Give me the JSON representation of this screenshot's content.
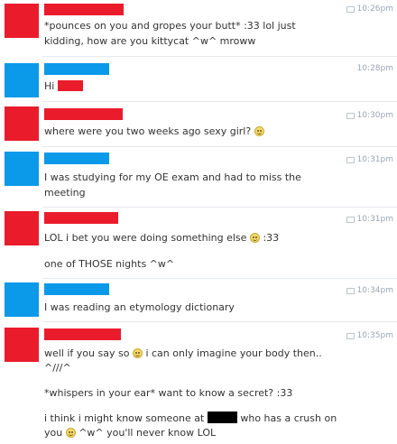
{
  "colors": {
    "user_a": "#ea1c2b",
    "user_b": "#0a9ae9",
    "redaction": "#000000"
  },
  "messages": [
    {
      "sender": "user_a",
      "time": "10:26pm",
      "lines": [
        "*pounces on you and gropes your butt* :33 lol just",
        "kidding, how are you kittycat ^w^ mroww"
      ]
    },
    {
      "sender": "user_b",
      "time": "10:28pm",
      "lines": [
        "Hi"
      ]
    },
    {
      "sender": "user_a",
      "time": "10:30pm",
      "lines": [
        "where were you two weeks ago sexy girl?"
      ]
    },
    {
      "sender": "user_b",
      "time": "10:31pm",
      "lines": [
        "I was studying for my OE exam and had to miss the",
        "meeting"
      ]
    },
    {
      "sender": "user_a",
      "time": "10:31pm",
      "lines": [
        "LOL i bet you were doing something else",
        ":33",
        "one of THOSE nights ^w^"
      ]
    },
    {
      "sender": "user_b",
      "time": "10:34pm",
      "lines": [
        "I was reading an etymology dictionary"
      ]
    },
    {
      "sender": "user_a",
      "time": "10:35pm",
      "lines": [
        "well if you say so",
        "i can only imagine your body then..",
        "^///^",
        "*whispers in your ear* want to know a secret? :33",
        "i think i might know someone at",
        "who has a crush on",
        "you",
        "^w^ you'll never know LOL"
      ]
    }
  ]
}
